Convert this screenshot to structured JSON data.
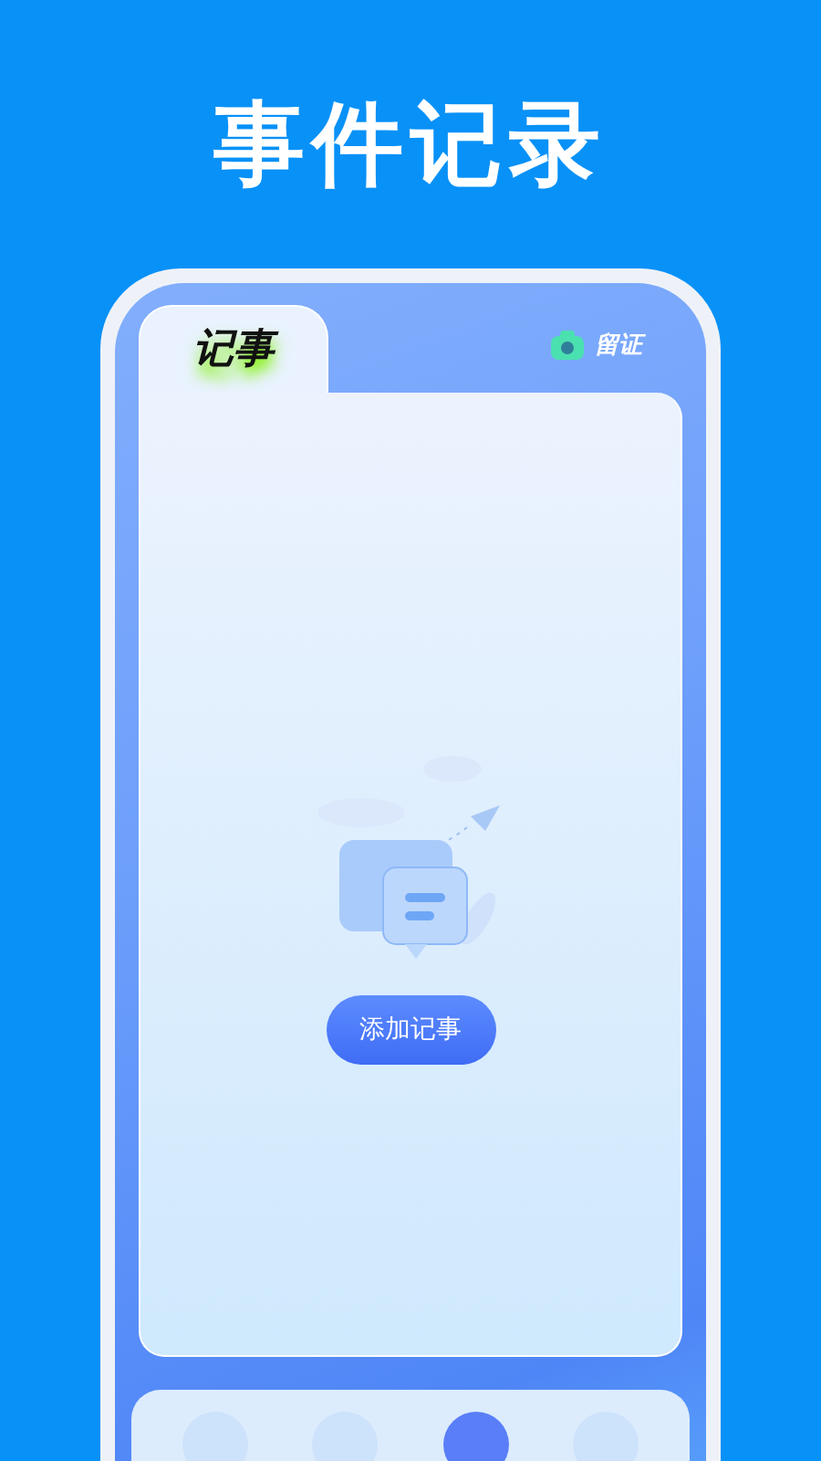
{
  "title": "事件记录",
  "tabs": [
    {
      "label": "记事",
      "selected": true
    },
    {
      "label": "留证",
      "selected": false
    }
  ],
  "add_button": {
    "label": "添加记事"
  },
  "bottom_nav": [
    {
      "selected": false
    },
    {
      "selected": false
    },
    {
      "selected": true
    },
    {
      "selected": false
    }
  ]
}
